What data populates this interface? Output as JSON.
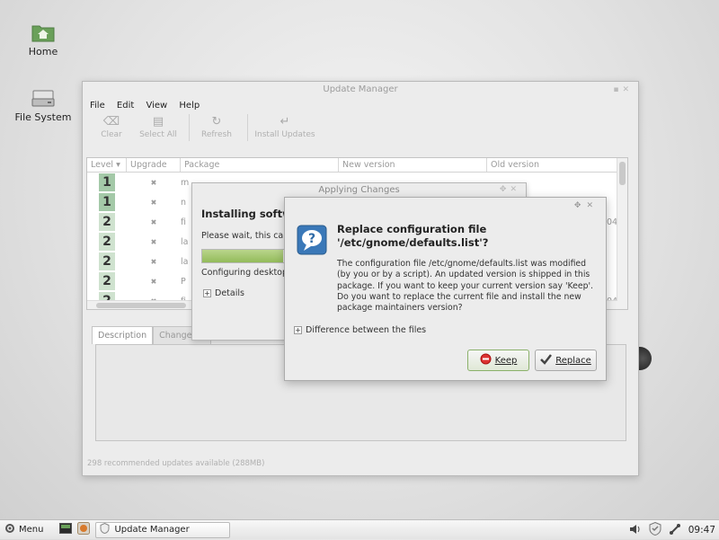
{
  "desktop": {
    "icons": [
      {
        "label": "Home"
      },
      {
        "label": "File System"
      }
    ]
  },
  "update_manager": {
    "title": "Update Manager",
    "menu": [
      "File",
      "Edit",
      "View",
      "Help"
    ],
    "toolbar": {
      "clear": "Clear",
      "select_all": "Select All",
      "refresh": "Refresh",
      "install_updates": "Install Updates"
    },
    "columns": [
      "Level",
      "Upgrade",
      "Package",
      "New version",
      "Old version"
    ],
    "rows": [
      {
        "level": "1",
        "package": "m"
      },
      {
        "level": "1",
        "package": "n"
      },
      {
        "level": "2",
        "package": "fi",
        "old": "04."
      },
      {
        "level": "2",
        "package": "la"
      },
      {
        "level": "2",
        "package": "la"
      },
      {
        "level": "2",
        "package": "P"
      },
      {
        "level": "2",
        "package": "fi",
        "old": "04."
      }
    ],
    "tabs": [
      "Description",
      "Changelog"
    ],
    "status": "298 recommended updates available (288MB)"
  },
  "applying_changes": {
    "title": "Applying Changes",
    "heading": "Installing softw",
    "wait_text": "Please wait, this can",
    "progress": 0.26,
    "status_text": "Configuring desktop",
    "details_label": "Details"
  },
  "replace_dialog": {
    "heading_line1": "Replace configuration file",
    "heading_line2": "'/etc/gnome/defaults.list'?",
    "body": "The configuration file /etc/gnome/defaults.list was modified (by you or by a script). An updated version is shipped in this package. If you want to keep your current version say 'Keep'. Do you want to replace the current file and install the new package maintainers version?",
    "diff_label": "Difference between the files",
    "keep_label": "Keep",
    "replace_label": "Replace",
    "colors": {
      "keep_border": "#8bb16a",
      "accent_green": "#93bb5a"
    }
  },
  "panel": {
    "menu_label": "Menu",
    "task_label": "Update Manager",
    "clock": "09:47",
    "tray_icons": [
      "volume-icon",
      "shield-icon",
      "network-icon"
    ]
  }
}
